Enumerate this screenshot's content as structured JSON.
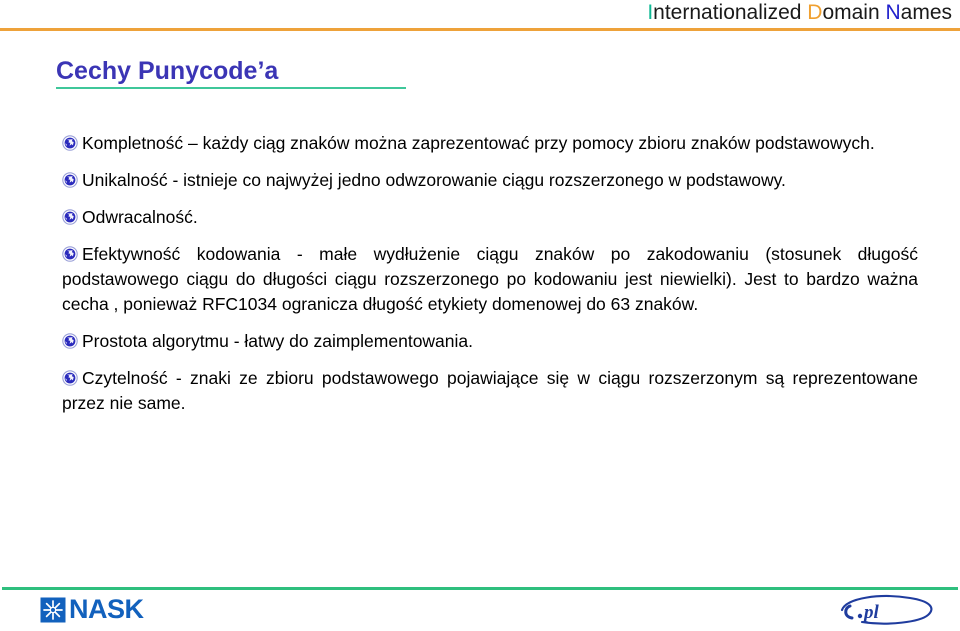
{
  "header": {
    "title_full": "Internationalized Domain Names",
    "title_parts": {
      "i_cap": "I",
      "i_rest": "nternationalized ",
      "d_cap": "D",
      "d_rest": "omain ",
      "n_cap": "N",
      "n_rest": "ames"
    },
    "rule_color": "#eea23a",
    "cap_colors": {
      "i": "#0fb894",
      "d": "#f0a030",
      "n": "#2222cc"
    }
  },
  "slide": {
    "title": "Cechy Punycode’a",
    "title_color": "#3b35b5",
    "title_rule_color": "#3fc79a"
  },
  "bullets": [
    {
      "icon": "globe-icon",
      "text": "Kompletność – każdy ciąg znaków można zaprezentować przy pomocy zbioru znaków podstawowych."
    },
    {
      "icon": "globe-icon",
      "text": "Unikalność - istnieje co najwyżej jedno odwzorowanie ciągu rozszerzonego w podstawowy."
    },
    {
      "icon": "globe-icon",
      "text": "Odwracalność."
    },
    {
      "icon": "globe-icon",
      "text": "Efektywność kodowania - małe wydłużenie ciągu znaków po zakodowaniu (stosunek długość podstawowego ciągu do długości ciągu rozszerzonego po kodowaniu jest niewielki). Jest to bardzo ważna cecha , ponieważ  RFC1034 ogranicza długość etykiety domenowej do 63 znaków."
    },
    {
      "icon": "globe-icon",
      "text": "Prostota algorytmu - łatwy do zaimplementowania."
    },
    {
      "icon": "globe-icon",
      "text": "Czytelność - znaki ze zbioru podstawowego pojawiające się w ciągu rozszerzonym są reprezentowane przez nie same."
    }
  ],
  "footer": {
    "rule_color": "#2fbf7e",
    "left_logo": {
      "name": "nask-logo",
      "wordmark": "NASK",
      "color": "#1261bd"
    },
    "right_logo": {
      "name": "dot-pl-logo",
      "wordmark": ".pl",
      "color": "#1f3c9e"
    }
  }
}
